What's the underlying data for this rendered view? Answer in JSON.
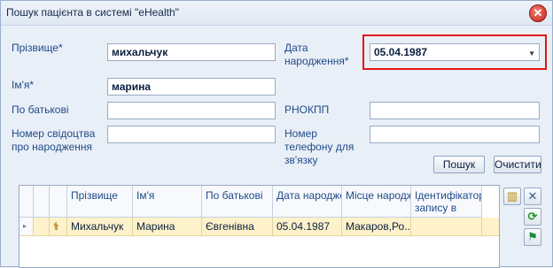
{
  "window": {
    "title": "Пошук пацієнта в системі \"eHealth\"",
    "close_glyph": "✕"
  },
  "form": {
    "surname_label": "Прізвище*",
    "surname_value": "михальчук",
    "name_label": "Ім'я*",
    "name_value": "марина",
    "patronymic_label": "По батькові",
    "patronymic_value": "",
    "birth_cert_label": "Номер свідоцтва про народження",
    "birth_cert_value": "",
    "birth_date_label": "Дата народження*",
    "birth_date_value": "05.04.1987",
    "rnokpp_label": "РНОКПП",
    "rnokpp_value": "",
    "phone_label": "Номер телефону для зв'язку",
    "phone_value": "",
    "search_button": "Пошук",
    "clear_button": "Очистити"
  },
  "grid": {
    "columns": [
      "Прізвище",
      "Ім'я",
      "По батькові",
      "Дата народже",
      "Місце народж",
      "Ідентифікатор запису в систе"
    ],
    "rows": [
      {
        "surname": "Михальчук",
        "name": "Марина",
        "patronymic": "Євгенівна",
        "birth_date": "05.04.1987",
        "birth_place": "Макаров,Ро...",
        "record_id": ""
      }
    ]
  },
  "toolbar": {
    "icons": [
      "book-icon",
      "tools-icon",
      "refresh-icon",
      "flag-icon"
    ]
  },
  "colors": {
    "highlight": "#e01818",
    "selected_row": "#fdf2c9",
    "title_bg": "#dfe8f3"
  }
}
